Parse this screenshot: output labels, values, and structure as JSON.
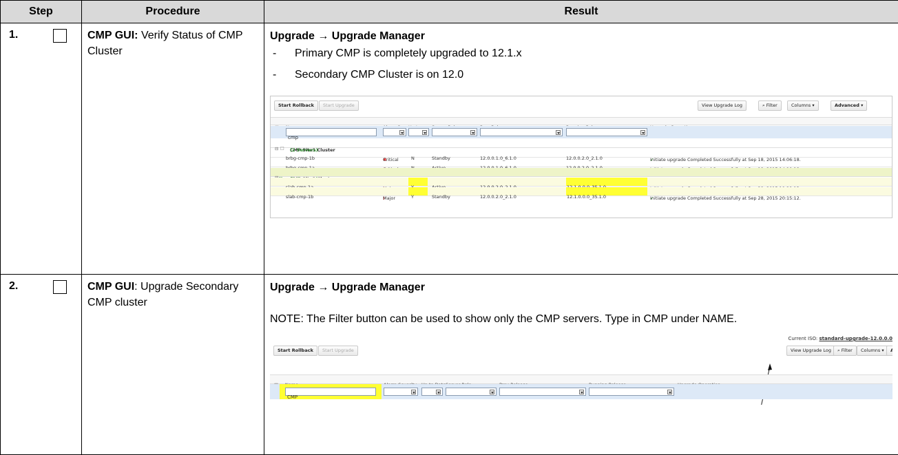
{
  "headers": {
    "step": "Step",
    "procedure": "Procedure",
    "result": "Result"
  },
  "row1": {
    "step": "1.",
    "proc_bold": "CMP GUI:",
    "proc_text": "Verify Status of CMP Cluster",
    "result_head": "Upgrade → Upgrade  Manager",
    "bullets": [
      "Primary CMP is completely upgraded to 12.1.x",
      "Secondary CMP Cluster is on 12.0"
    ],
    "shot": {
      "buttons": [
        "Start Rollback",
        "Start Upgrade"
      ],
      "right_buttons": [
        "View Upgrade Log",
        "⌕ Filter",
        "Columns ▾",
        "Advanced ▾"
      ],
      "columns": [
        "Name",
        "Alarm Se...",
        "Up to ...",
        "Server Role",
        "Prev Release",
        "Running Release",
        "Upgrade Operation"
      ],
      "filter_name": "cmp",
      "groups": [
        {
          "label": "CMP Site1 Cluster",
          "count": "(2 Servers)",
          "rows": [
            {
              "name": "brbg-cmp-1b",
              "alarm": "Critical",
              "uptodate": "N",
              "role": "Standby",
              "prev": "12.0.0.1.0_6.1.0",
              "running": "12.0.0.2.0_2.1.0",
              "op": "Initiate upgrade Completed Successfully at Sep 18, 2015 14:06:18."
            },
            {
              "name": "brbg-cmp-1a",
              "alarm": "Critical",
              "uptodate": "N",
              "role": "Active",
              "prev": "12.0.0.1.0_6.1.0",
              "running": "12.0.0.2.0_2.1.0",
              "op": "Initiate upgrade Completed Successfully at Sep 18, 2015 14:10:18."
            }
          ]
        },
        {
          "label": "CMP Site2 Cluster",
          "count": "(2 Servers)",
          "rows": [
            {
              "name": "slab-cmp-1a",
              "alarm": "Major",
              "uptodate": "Y",
              "role": "Active",
              "prev": "12.0.0.2.0_2.1.0",
              "running": "12.1.0.0.0_35.1.0",
              "op": "Initiate upgrade Completed Successfully at Sep 28, 2015 19:28:13."
            },
            {
              "name": "slab-cmp-1b",
              "alarm": "Major",
              "uptodate": "Y",
              "role": "Standby",
              "prev": "12.0.0.2.0_2.1.0",
              "running": "12.1.0.0.0_35.1.0",
              "op": "Initiate upgrade Completed Successfully at Sep 28, 2015 20:15:12."
            }
          ]
        }
      ]
    }
  },
  "row2": {
    "step": "2.",
    "proc_bold": "CMP GUI",
    "proc_text": ": Upgrade Secondary CMP cluster",
    "result_head": "Upgrade → Upgrade  Manager",
    "note": "NOTE: The Filter button can be used to show only the CMP servers. Type in CMP under NAME.",
    "shot": {
      "current_iso_label": "Current ISO:",
      "current_iso_value": "standard-upgrade-12.0.0.0",
      "buttons": [
        "Start Rollback",
        "Start Upgrade"
      ],
      "right_buttons": [
        "View Upgrade Log",
        "⌕ Filter",
        "Columns ▾",
        "Adva"
      ],
      "columns": [
        "Name",
        "Alarm Severity",
        "Up to Date",
        "Server Role",
        "Prev Release",
        "Running Release",
        "Upgrade Operation"
      ],
      "filter_name": "CMP"
    }
  }
}
